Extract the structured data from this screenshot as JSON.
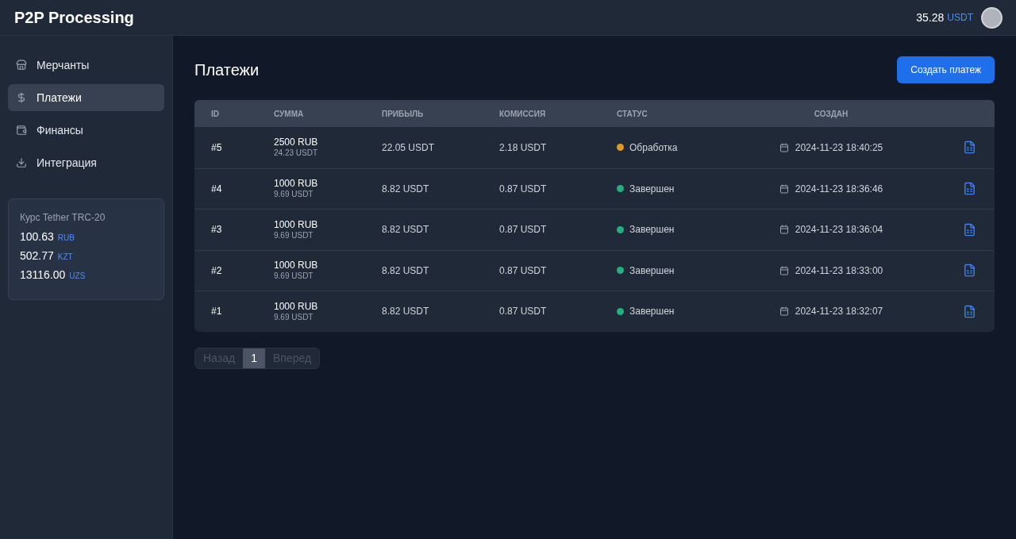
{
  "header": {
    "title": "P2P Processing",
    "balance": "35.28",
    "currency": "USDT"
  },
  "sidebar": {
    "items": [
      {
        "label": "Мерчанты",
        "selected": false
      },
      {
        "label": "Платежи",
        "selected": true
      },
      {
        "label": "Финансы",
        "selected": false
      },
      {
        "label": "Интеграция",
        "selected": false
      }
    ],
    "rates": {
      "title": "Курс Tether TRC-20",
      "items": [
        {
          "value": "100.63",
          "currency": "RUB"
        },
        {
          "value": "502.77",
          "currency": "KZT"
        },
        {
          "value": "13116.00",
          "currency": "UZS"
        }
      ]
    }
  },
  "page": {
    "title": "Платежи",
    "create_button": "Создать платеж"
  },
  "table": {
    "columns": [
      "ID",
      "СУММА",
      "ПРИБЫЛЬ",
      "КОМИССИЯ",
      "СТАТУС",
      "СОЗДАН"
    ],
    "rows": [
      {
        "id": "#5",
        "amount": "2500 RUB",
        "amount_usdt": "24.23 USDT",
        "profit": "22.05 USDT",
        "fee": "2.18 USDT",
        "status": "Обработка",
        "color": "#e09a1c",
        "created": "2024-11-23 18:40:25"
      },
      {
        "id": "#4",
        "amount": "1000 RUB",
        "amount_usdt": "9.69 USDT",
        "profit": "8.82 USDT",
        "fee": "0.87 USDT",
        "status": "Завершен",
        "color": "#22b07d",
        "created": "2024-11-23 18:36:46"
      },
      {
        "id": "#3",
        "amount": "1000 RUB",
        "amount_usdt": "9.69 USDT",
        "profit": "8.82 USDT",
        "fee": "0.87 USDT",
        "status": "Завершен",
        "color": "#22b07d",
        "created": "2024-11-23 18:36:04"
      },
      {
        "id": "#2",
        "amount": "1000 RUB",
        "amount_usdt": "9.69 USDT",
        "profit": "8.82 USDT",
        "fee": "0.87 USDT",
        "status": "Завершен",
        "color": "#22b07d",
        "created": "2024-11-23 18:33:00"
      },
      {
        "id": "#1",
        "amount": "1000 RUB",
        "amount_usdt": "9.69 USDT",
        "profit": "8.82 USDT",
        "fee": "0.87 USDT",
        "status": "Завершен",
        "color": "#22b07d",
        "created": "2024-11-23 18:32:07"
      }
    ]
  },
  "pagination": {
    "prev": {
      "label": "Назад",
      "disabled": true
    },
    "pages": [
      {
        "label": "1",
        "selected": true
      }
    ],
    "next": {
      "label": "Вперед",
      "disabled": true
    }
  }
}
